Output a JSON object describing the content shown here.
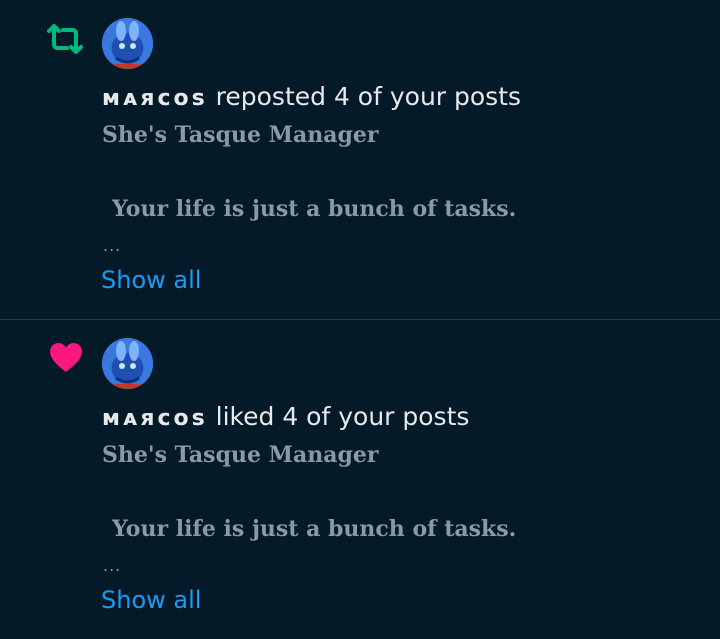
{
  "notifications": [
    {
      "type_icon": "repost-icon",
      "icon_color": "#00ba7c",
      "user_name": "ᴍᴀяᴄᴏѕ",
      "action_text": "reposted 4 of your posts",
      "post_title": "She's Tasque Manager",
      "post_body": "Your life is just a bunch of tasks.",
      "ellipsis": "...",
      "show_all": "Show all"
    },
    {
      "type_icon": "heart-icon",
      "icon_color": "#f91880",
      "user_name": "ᴍᴀяᴄᴏѕ",
      "action_text": "liked 4 of your posts",
      "post_title": "She's Tasque Manager",
      "post_body": "Your life is just a bunch of tasks.",
      "ellipsis": "...",
      "show_all": "Show all"
    }
  ],
  "colors": {
    "background": "#041a29",
    "link": "#1d9bf0",
    "muted_text": "#8b98a5",
    "primary_text": "#e7e9ea"
  }
}
